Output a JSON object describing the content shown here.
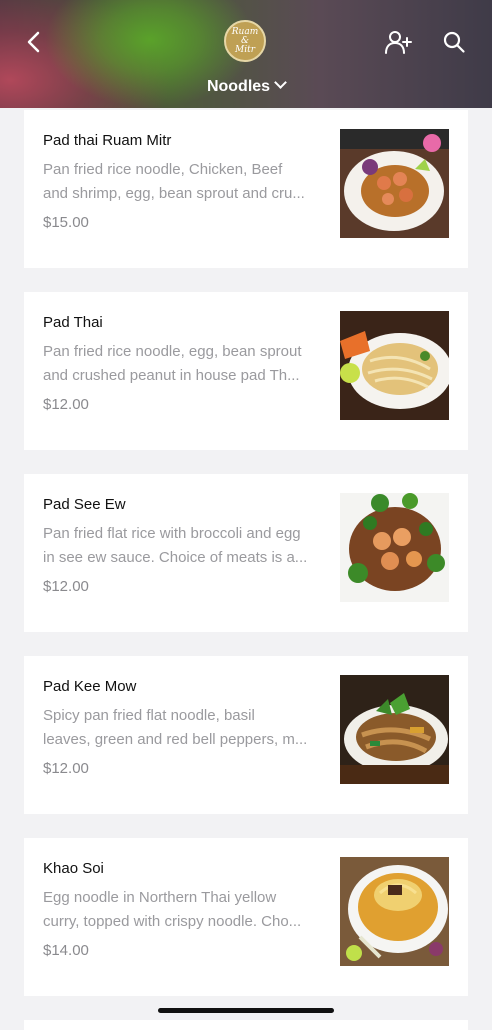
{
  "header": {
    "logo_text_line1": "Ruam",
    "logo_text_line2": "&",
    "logo_text_line3": "Mitr",
    "category": "Noodles",
    "icons": [
      "back-icon",
      "add-user-icon",
      "search-icon"
    ]
  },
  "items": [
    {
      "name": "Pad thai Ruam Mitr",
      "desc1": "Pan fried rice noodle, Chicken, Beef",
      "desc2": "and shrimp, egg, bean sprout and cru...",
      "price": "$15.00"
    },
    {
      "name": "Pad Thai",
      "desc1": "Pan fried rice noodle, egg, bean sprout",
      "desc2": "and crushed peanut in house pad Th...",
      "price": "$12.00"
    },
    {
      "name": "Pad See Ew",
      "desc1": "Pan fried flat rice with broccoli and egg",
      "desc2": "in see ew sauce. Choice of meats is a...",
      "price": "$12.00"
    },
    {
      "name": "Pad Kee Mow",
      "desc1": "Spicy pan fried flat noodle, basil",
      "desc2": "leaves, green and red bell peppers, m...",
      "price": "$12.00"
    },
    {
      "name": "Khao Soi",
      "desc1": "Egg noodle in Northern Thai yellow",
      "desc2": "curry, topped with crispy noodle. Cho...",
      "price": "$14.00"
    }
  ]
}
